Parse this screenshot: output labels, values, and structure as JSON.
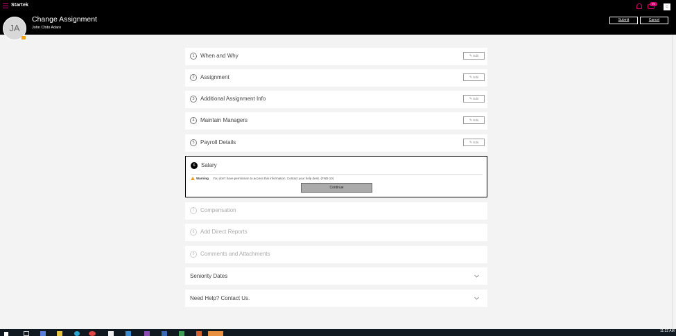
{
  "topbar": {
    "brand": "Startek",
    "notification_count": "99"
  },
  "header": {
    "title": "Change Assignment",
    "subtitle": "John Chito Adaro",
    "avatar_initials": "JA",
    "submit_label": "Submit",
    "cancel_label": "Cancel"
  },
  "sections": [
    {
      "number": "1",
      "label": "When and Why",
      "edit_label": "Edit"
    },
    {
      "number": "2",
      "label": "Assignment",
      "edit_label": "Edit"
    },
    {
      "number": "3",
      "label": "Additional Assignment Info",
      "edit_label": "Edit"
    },
    {
      "number": "4",
      "label": "Maintain Managers",
      "edit_label": "Edit"
    },
    {
      "number": "5",
      "label": "Payroll Details",
      "edit_label": "Edit"
    }
  ],
  "salary": {
    "number": "6",
    "label": "Salary",
    "warning_title": "Warning",
    "warning_text": "You don't have permission to access this information. Contact your help desk. (FND-10)",
    "continue_label": "Continue"
  },
  "pending_sections": [
    {
      "number": "7",
      "label": "Compensation"
    },
    {
      "number": "8",
      "label": "Add Direct Reports"
    },
    {
      "number": "9",
      "label": "Comments and Attachments"
    }
  ],
  "collapsibles": [
    {
      "label": "Seniority Dates"
    },
    {
      "label": "Need Help? Contact Us."
    }
  ],
  "taskbar": {
    "clock": "11:22 AM"
  },
  "colors": {
    "accent": "#d4006f",
    "header_bg": "#000000",
    "warning": "#f0a020"
  }
}
